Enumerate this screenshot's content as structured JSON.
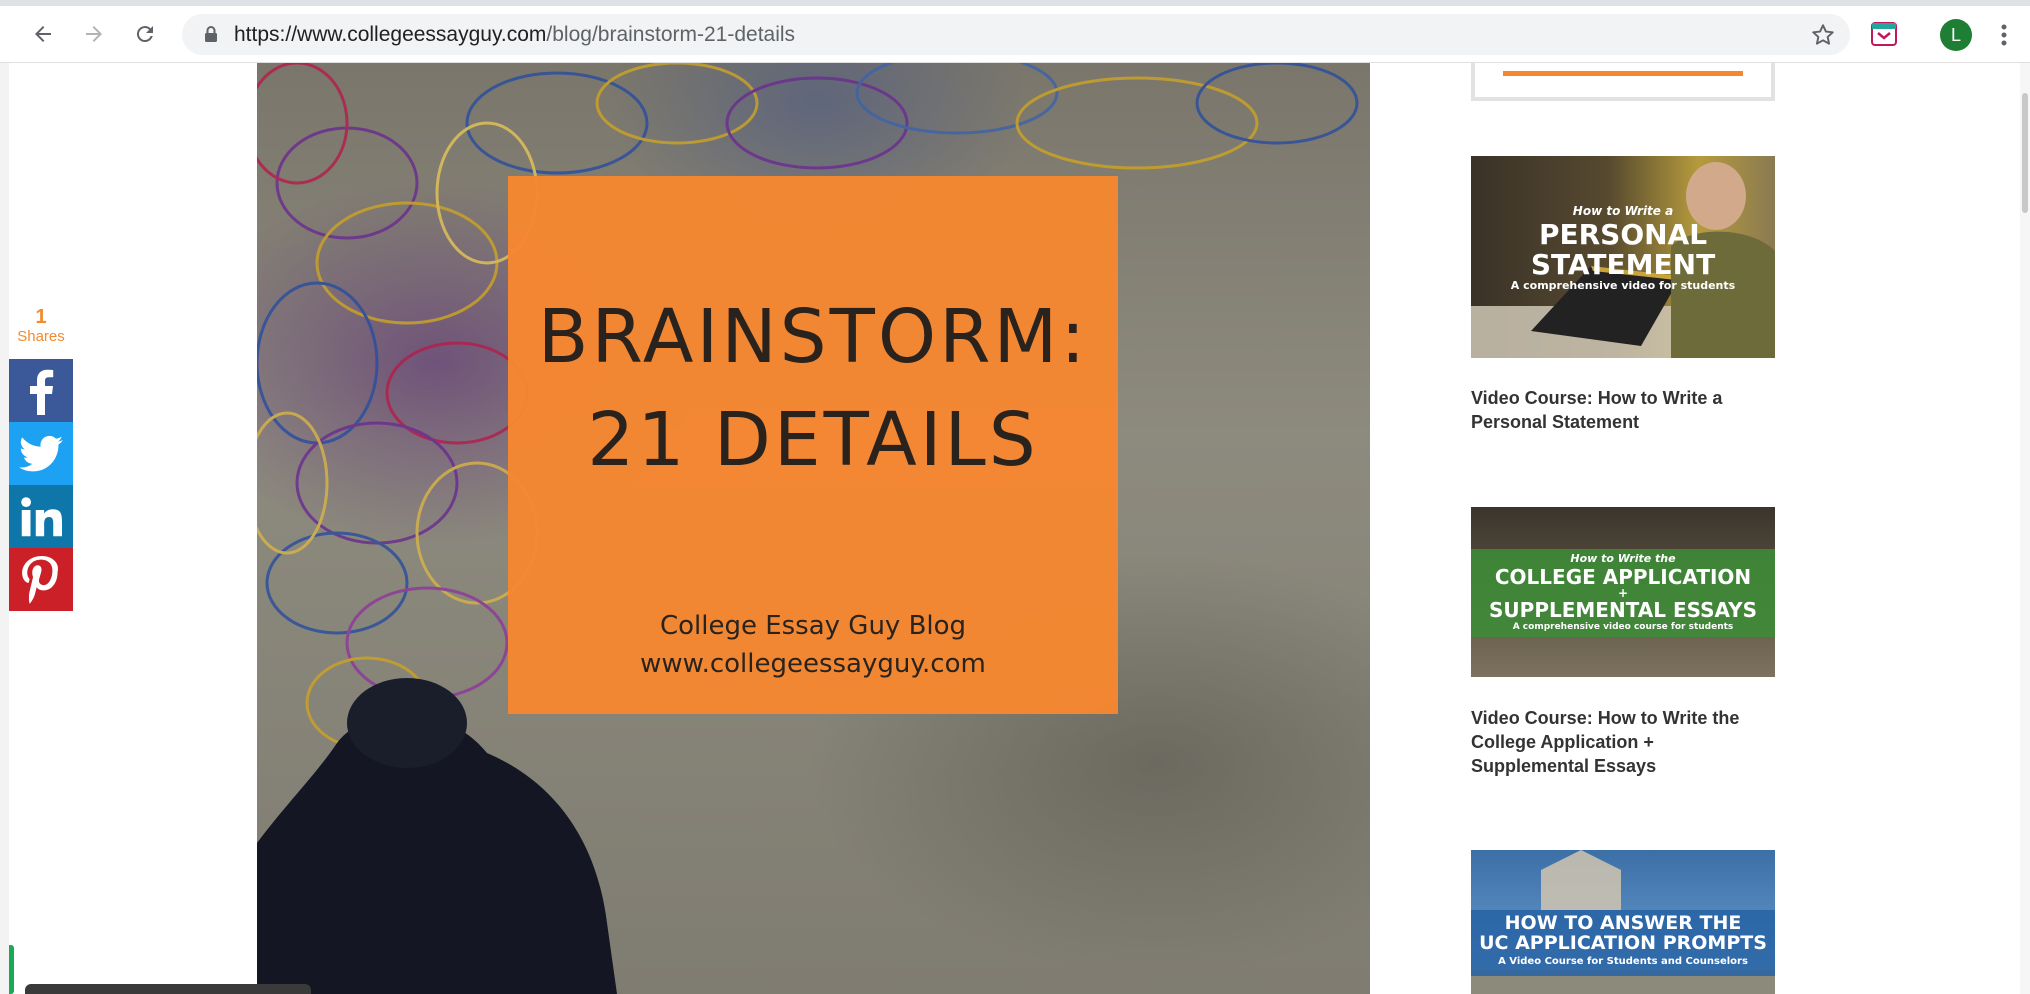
{
  "browser": {
    "url_host": "https://www.collegeessayguy.com",
    "url_path": "/blog/brainstorm-21-details",
    "avatar_letter": "L"
  },
  "share_bar": {
    "count": "1",
    "label": "Shares",
    "buttons": [
      "facebook-share-button",
      "twitter-share-button",
      "linkedin-share-button",
      "pinterest-share-button"
    ]
  },
  "hero": {
    "title_line1": "BRAINSTORM:",
    "title_line2": "21 DETAILS",
    "subtitle_line1": "College Essay Guy Blog",
    "subtitle_line2": "www.collegeessayguy.com"
  },
  "sidebar": {
    "items": [
      {
        "image_text": {
          "kicker": "How to Write a",
          "line1": "PERSONAL",
          "line2": "STATEMENT",
          "tagline": "A comprehensive video for students"
        },
        "link": "Video Course: How to Write a Personal Statement"
      },
      {
        "image_text": {
          "kicker": "How to Write the",
          "line1": "COLLEGE APPLICATION",
          "plus": "+",
          "line2": "SUPPLEMENTAL ESSAYS",
          "tagline": "A comprehensive video course for students"
        },
        "link": "Video Course: How to Write the College Application + Supplemental Essays"
      },
      {
        "image_text": {
          "line1": "HOW TO ANSWER THE",
          "line2": "UC APPLICATION PROMPTS",
          "tagline": "A Video Course for Students and Counselors"
        }
      }
    ]
  },
  "colors": {
    "brand_orange": "#f7872f",
    "share_orange": "#f28a2e",
    "facebook": "#3b5998",
    "twitter": "#1da1f2",
    "linkedin": "#0e76a8",
    "pinterest": "#cb2027"
  }
}
